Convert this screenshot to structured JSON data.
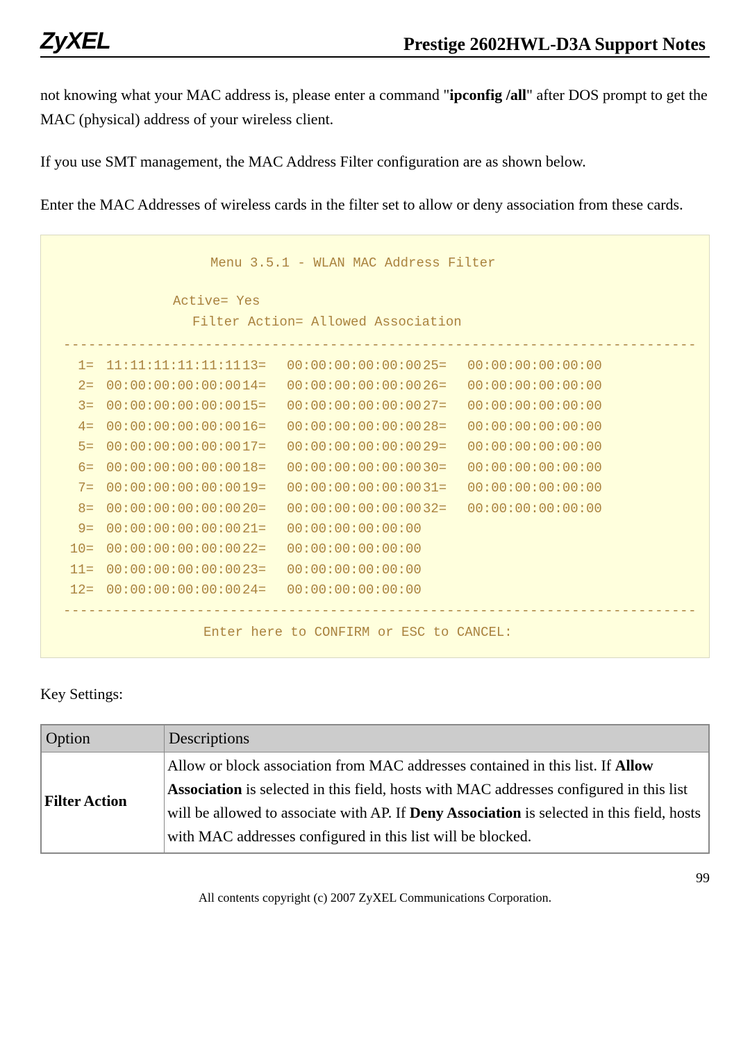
{
  "header": {
    "logo": "ZyXEL",
    "title": "Prestige 2602HWL-D3A Support Notes"
  },
  "paragraphs": {
    "p1_a": "not knowing what your MAC address is, please enter a command \"",
    "p1_b": "ipconfig /all",
    "p1_c": "\" after DOS prompt to get the MAC (physical) address of your wireless client.",
    "p2": "If you use SMT management, the MAC Address Filter configuration are as shown below.",
    "p3": "Enter the MAC Addresses of wireless cards in the filter set to allow or deny association from these cards.",
    "keysettings": "Key Settings:"
  },
  "terminal": {
    "title": "Menu 3.5.1 - WLAN MAC Address Filter",
    "active": "Active= Yes",
    "filter": "Filter Action= Allowed Association",
    "dash": " ------------------------------------------------------------------------------",
    "rows": [
      {
        "a": " 1=",
        "am": "11:11:11:11:11:11",
        "b": "13=",
        "bm": "00:00:00:00:00:00",
        "c": "25=",
        "cm": "00:00:00:00:00:00"
      },
      {
        "a": " 2=",
        "am": "00:00:00:00:00:00",
        "b": "14=",
        "bm": "00:00:00:00:00:00",
        "c": "26=",
        "cm": "00:00:00:00:00:00"
      },
      {
        "a": " 3=",
        "am": "00:00:00:00:00:00",
        "b": "15=",
        "bm": "00:00:00:00:00:00",
        "c": "27=",
        "cm": "00:00:00:00:00:00"
      },
      {
        "a": " 4=",
        "am": "00:00:00:00:00:00",
        "b": "16=",
        "bm": "00:00:00:00:00:00",
        "c": "28=",
        "cm": "00:00:00:00:00:00"
      },
      {
        "a": " 5=",
        "am": "00:00:00:00:00:00",
        "b": "17=",
        "bm": "00:00:00:00:00:00",
        "c": "29=",
        "cm": "00:00:00:00:00:00"
      },
      {
        "a": " 6=",
        "am": "00:00:00:00:00:00",
        "b": "18=",
        "bm": "00:00:00:00:00:00",
        "c": "30=",
        "cm": "00:00:00:00:00:00"
      },
      {
        "a": " 7=",
        "am": "00:00:00:00:00:00",
        "b": "19=",
        "bm": "00:00:00:00:00:00",
        "c": "31=",
        "cm": "00:00:00:00:00:00"
      },
      {
        "a": " 8=",
        "am": "00:00:00:00:00:00",
        "b": "20=",
        "bm": "00:00:00:00:00:00",
        "c": "32=",
        "cm": "00:00:00:00:00:00"
      },
      {
        "a": " 9=",
        "am": "00:00:00:00:00:00",
        "b": "21=",
        "bm": "00:00:00:00:00:00",
        "c": "",
        "cm": ""
      },
      {
        "a": "10=",
        "am": "00:00:00:00:00:00",
        "b": "22=",
        "bm": "00:00:00:00:00:00",
        "c": "",
        "cm": ""
      },
      {
        "a": "11=",
        "am": "00:00:00:00:00:00",
        "b": "23=",
        "bm": "00:00:00:00:00:00",
        "c": "",
        "cm": ""
      },
      {
        "a": "12=",
        "am": "00:00:00:00:00:00",
        "b": "24=",
        "bm": "00:00:00:00:00:00",
        "c": "",
        "cm": ""
      }
    ],
    "confirm": "Enter here to CONFIRM or ESC to CANCEL:"
  },
  "table": {
    "h1": "Option",
    "h2": "Descriptions",
    "row1_opt": "Filter Action",
    "row1_a": "Allow or block association from MAC addresses contained in this list. If ",
    "row1_b": "Allow Association",
    "row1_c": " is selected in this field, hosts with MAC addresses configured in this list will be allowed to associate with AP. If ",
    "row1_d": "Deny Association",
    "row1_e": " is selected in this field, hosts with MAC addresses configured in this list will be blocked."
  },
  "footer": {
    "pagenum": "99",
    "copyright": "All contents copyright (c) 2007 ZyXEL Communications Corporation."
  }
}
